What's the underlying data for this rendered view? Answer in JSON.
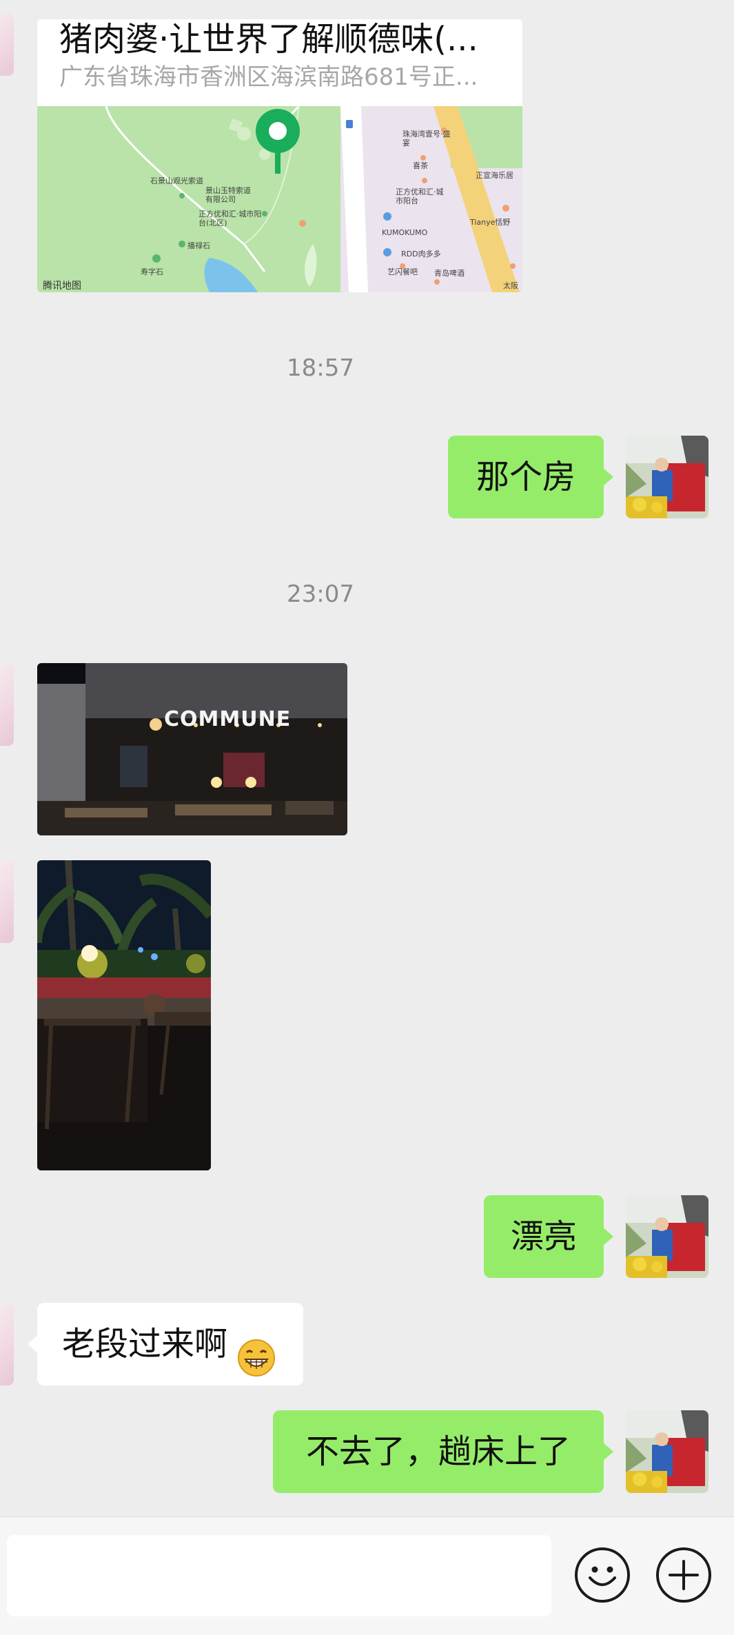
{
  "location": {
    "title": "猪肉婆·让世界了解顺德味(...",
    "address": "广东省珠海市香洲区海滨南路681号正...",
    "map_labels": [
      "石景山观光索道",
      "景山玉特索道有限公司",
      "正方优和汇·城市阳台(北区)",
      "珠海湾壹号·盛宴",
      "喜茶",
      "正方优和汇·城市阳台",
      "KUMOKUMO",
      "RDD肉多多",
      "艺闪餐吧",
      "青岛啤酒",
      "正宣海乐居",
      "Tianye恬野",
      "太阪",
      "播禄石",
      "寿字石"
    ],
    "map_brand": "腾讯地图"
  },
  "messages": [
    {
      "type": "time",
      "text": "18:57"
    },
    {
      "type": "text",
      "side": "right",
      "text": "那个房"
    },
    {
      "type": "time",
      "text": "23:07"
    },
    {
      "type": "image",
      "side": "left",
      "sign": "COMMUNE"
    },
    {
      "type": "image",
      "side": "left"
    },
    {
      "type": "text",
      "side": "right",
      "text": "漂亮"
    },
    {
      "type": "text",
      "side": "left",
      "text": "老段过来啊"
    },
    {
      "type": "text",
      "side": "right",
      "text": "不去了，趟床上了"
    }
  ],
  "icons": {
    "emoji_button": "smiley-icon",
    "more_button": "plus-icon",
    "grin_emoji": "grin-emoji-icon"
  },
  "colors": {
    "background": "#ededed",
    "sent_bubble": "#95ec69",
    "received_bubble": "#ffffff",
    "timestamp": "#8a8a8a"
  }
}
